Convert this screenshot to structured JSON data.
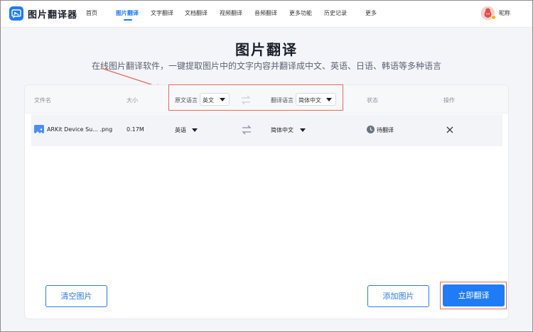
{
  "header": {
    "brand": "图片翻译器",
    "nav": [
      "首页",
      "图片翻译",
      "文字翻译",
      "文档翻译",
      "视频翻译",
      "音频翻译",
      "更多功能",
      "历史记录",
      "更多"
    ],
    "active_nav": "图片翻译",
    "user_nickname": "昵称"
  },
  "hero": {
    "title": "图片翻译",
    "subtitle": "在线图片翻译软件，一键提取图片中的文字内容并翻译成中文、英语、日语、韩语等多种语言"
  },
  "table": {
    "headers": {
      "filename": "文件名",
      "size": "大小",
      "source_lang_label": "原文语言",
      "source_lang_value": "英文",
      "target_lang_label": "翻译语言",
      "target_lang_value": "简体中文",
      "status": "状态",
      "action": "操作"
    },
    "rows": [
      {
        "filename": "ARKit Device Su... .png",
        "size": "0.17M",
        "source_lang": "英语",
        "target_lang": "简体中文",
        "status": "待翻译"
      }
    ]
  },
  "buttons": {
    "clear": "清空图片",
    "add": "添加图片",
    "translate": "立即翻译"
  },
  "colors": {
    "accent": "#1f7cf7",
    "annotation": "#e8675f"
  }
}
